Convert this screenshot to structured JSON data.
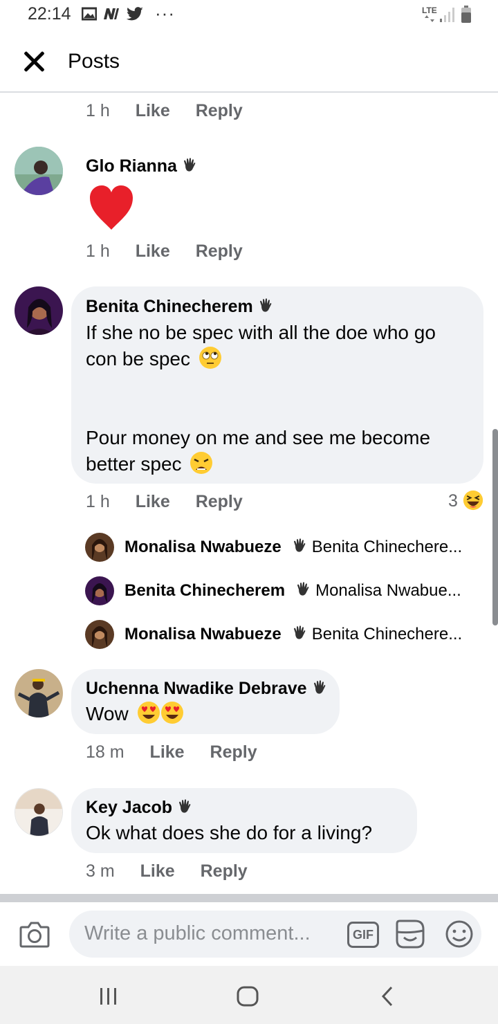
{
  "status_bar": {
    "time": "22:14",
    "network": "LTE",
    "more": "···"
  },
  "header": {
    "title": "Posts"
  },
  "comments": [
    {
      "time": "1 h",
      "like": "Like",
      "reply": "Reply"
    },
    {
      "name": "Glo Rianna",
      "time": "1 h",
      "like": "Like",
      "reply": "Reply"
    },
    {
      "name": "Benita Chinecherem",
      "text_line1": "If she no be spec with all the doe who go",
      "text_line2": "con be spec",
      "text_line3": "Pour money on me and see me become",
      "text_line4": "better spec",
      "time": "1 h",
      "like": "Like",
      "reply": "Reply",
      "reaction_count": "3",
      "replies": [
        {
          "name": "Monalisa Nwabueze",
          "preview": "Benita Chinechere..."
        },
        {
          "name": "Benita Chinecherem",
          "preview": "Monalisa Nwabue..."
        },
        {
          "name": "Monalisa Nwabueze",
          "preview": "Benita Chinechere..."
        }
      ]
    },
    {
      "name": "Uchenna Nwadike Debrave",
      "text": "Wow",
      "time": "18 m",
      "like": "Like",
      "reply": "Reply"
    },
    {
      "name": "Key Jacob",
      "text": "Ok what does she do for a living?",
      "time": "3 m",
      "like": "Like",
      "reply": "Reply"
    }
  ],
  "composer": {
    "placeholder": "Write a public comment...",
    "gif": "GIF"
  },
  "colors": {
    "bubble": "#f0f2f5",
    "meta": "#65676b",
    "heart": "#e8202a"
  }
}
